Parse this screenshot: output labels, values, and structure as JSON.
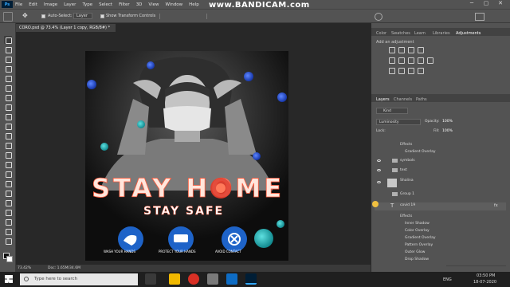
{
  "menu": {
    "items": [
      "File",
      "Edit",
      "Image",
      "Layer",
      "Type",
      "Select",
      "Filter",
      "3D",
      "View",
      "Window",
      "Help"
    ],
    "app_badge": "Ps"
  },
  "watermark": "www.BANDICAM.com",
  "options_bar": {
    "auto_select_label": "Auto-Select:",
    "auto_select_value": "Layer",
    "show_transform_label": "Show Transform Controls"
  },
  "document": {
    "tab_title": "CORO.psd @ 73.4% (Layer 1 copy, RGB/8#) *",
    "zoom": "73.42%",
    "doc_size": "Doc: 1.65M/34.6M",
    "headline": "STAY HOME",
    "subline": "STAY SAFE",
    "badges": [
      "WASH YOUR HANDS",
      "PROTECT YOUR HANDS",
      "AVOID CONTACT"
    ]
  },
  "panels": {
    "top_tabs": [
      "Color",
      "Swatches",
      "Learn",
      "Libraries",
      "Adjustments"
    ],
    "adjustment_hint": "Add an adjustment",
    "layer_tabs": [
      "Layers",
      "Channels",
      "Paths"
    ],
    "kind_label": "Kind",
    "blend_mode": "Luminosity",
    "opacity_label": "Opacity:",
    "opacity_value": "100%",
    "lock_label": "Lock:",
    "fill_label": "Fill:",
    "fill_value": "100%",
    "layers": [
      {
        "label": "Effects"
      },
      {
        "label": "Gradient Overlay"
      },
      {
        "label": "symbols"
      },
      {
        "label": "text"
      },
      {
        "label": "Shalina"
      },
      {
        "label": "Group 1"
      },
      {
        "label": "covid 19"
      },
      {
        "label": "Effects"
      },
      {
        "label": "Inner Shadow"
      },
      {
        "label": "Color Overlay"
      },
      {
        "label": "Gradient Overlay"
      },
      {
        "label": "Pattern Overlay"
      },
      {
        "label": "Outer Glow"
      },
      {
        "label": "Drop Shadow"
      }
    ],
    "fx_label": "fx"
  },
  "taskbar": {
    "search_placeholder": "Type here to search",
    "lang": "ENG",
    "time": "03:50 PM",
    "date": "18-07-2020"
  },
  "colors": {
    "accent": "#31a8ff",
    "headline_glow": "#ff5a3c",
    "badge_blue": "#1e63c8",
    "virus_blue": "#1f4fd6",
    "virus_teal": "#2bb0b3"
  }
}
